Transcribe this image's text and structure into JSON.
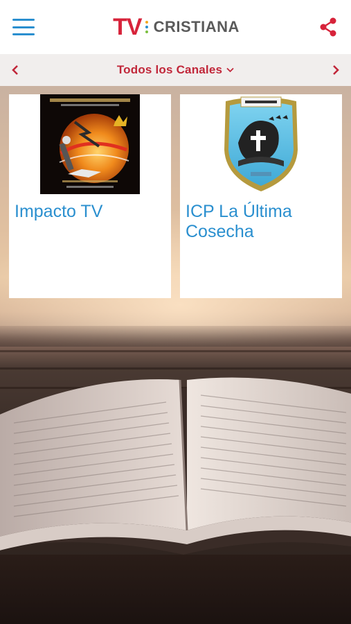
{
  "header": {
    "logo_tv": "TV",
    "logo_word": "CRISTIANA",
    "brand_blue": "#2a8fcf",
    "brand_red": "#d7233a"
  },
  "selector": {
    "label": "Todos los Canales",
    "label_color": "#c1273a"
  },
  "channels": [
    {
      "title": "Impacto TV",
      "logo_icon": "radio-impacto-tv-logo"
    },
    {
      "title": "ICP La Última Cosecha",
      "logo_icon": "icpluc-shield-logo"
    }
  ],
  "icons": {
    "menu": "hamburger-menu-icon",
    "share": "share-icon",
    "prev": "chevron-left-icon",
    "next": "chevron-right-icon",
    "dropdown": "chevron-down-icon"
  }
}
